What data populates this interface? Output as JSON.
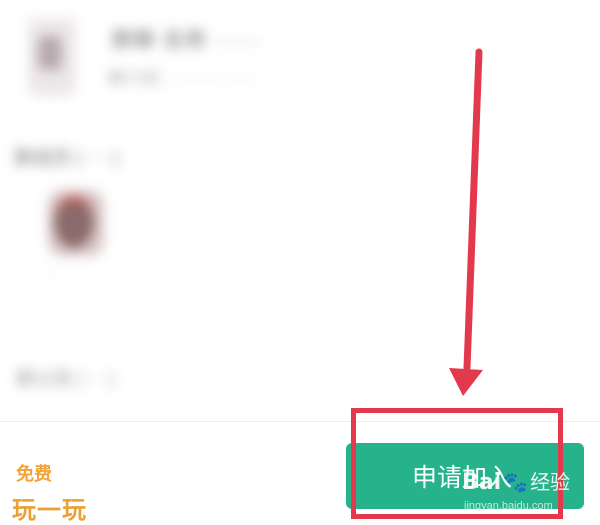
{
  "group": {
    "name": "群聊 名称 ······",
    "description": "群介绍 ·· ······· ·····"
  },
  "sections": {
    "members_label": "群成员 ( ··· )",
    "more_label": "群公告 ( ·· )",
    "member_name": "······"
  },
  "bottom_bar": {
    "join_label": "申请加入"
  },
  "watermarks": {
    "badge_line1": "免费",
    "badge_line2": "玩一玩",
    "baidu_brand": "Bai",
    "baidu_jingyan": "经验",
    "baidu_url": "jingyan.baidu.com"
  },
  "icons": {
    "arrow": "red-down-arrow-annotation",
    "paw": "baidu-paw-icon"
  },
  "colors": {
    "join_button": "#26b38c",
    "annotation": "#e23a4c",
    "badge": "#f1a33a"
  }
}
